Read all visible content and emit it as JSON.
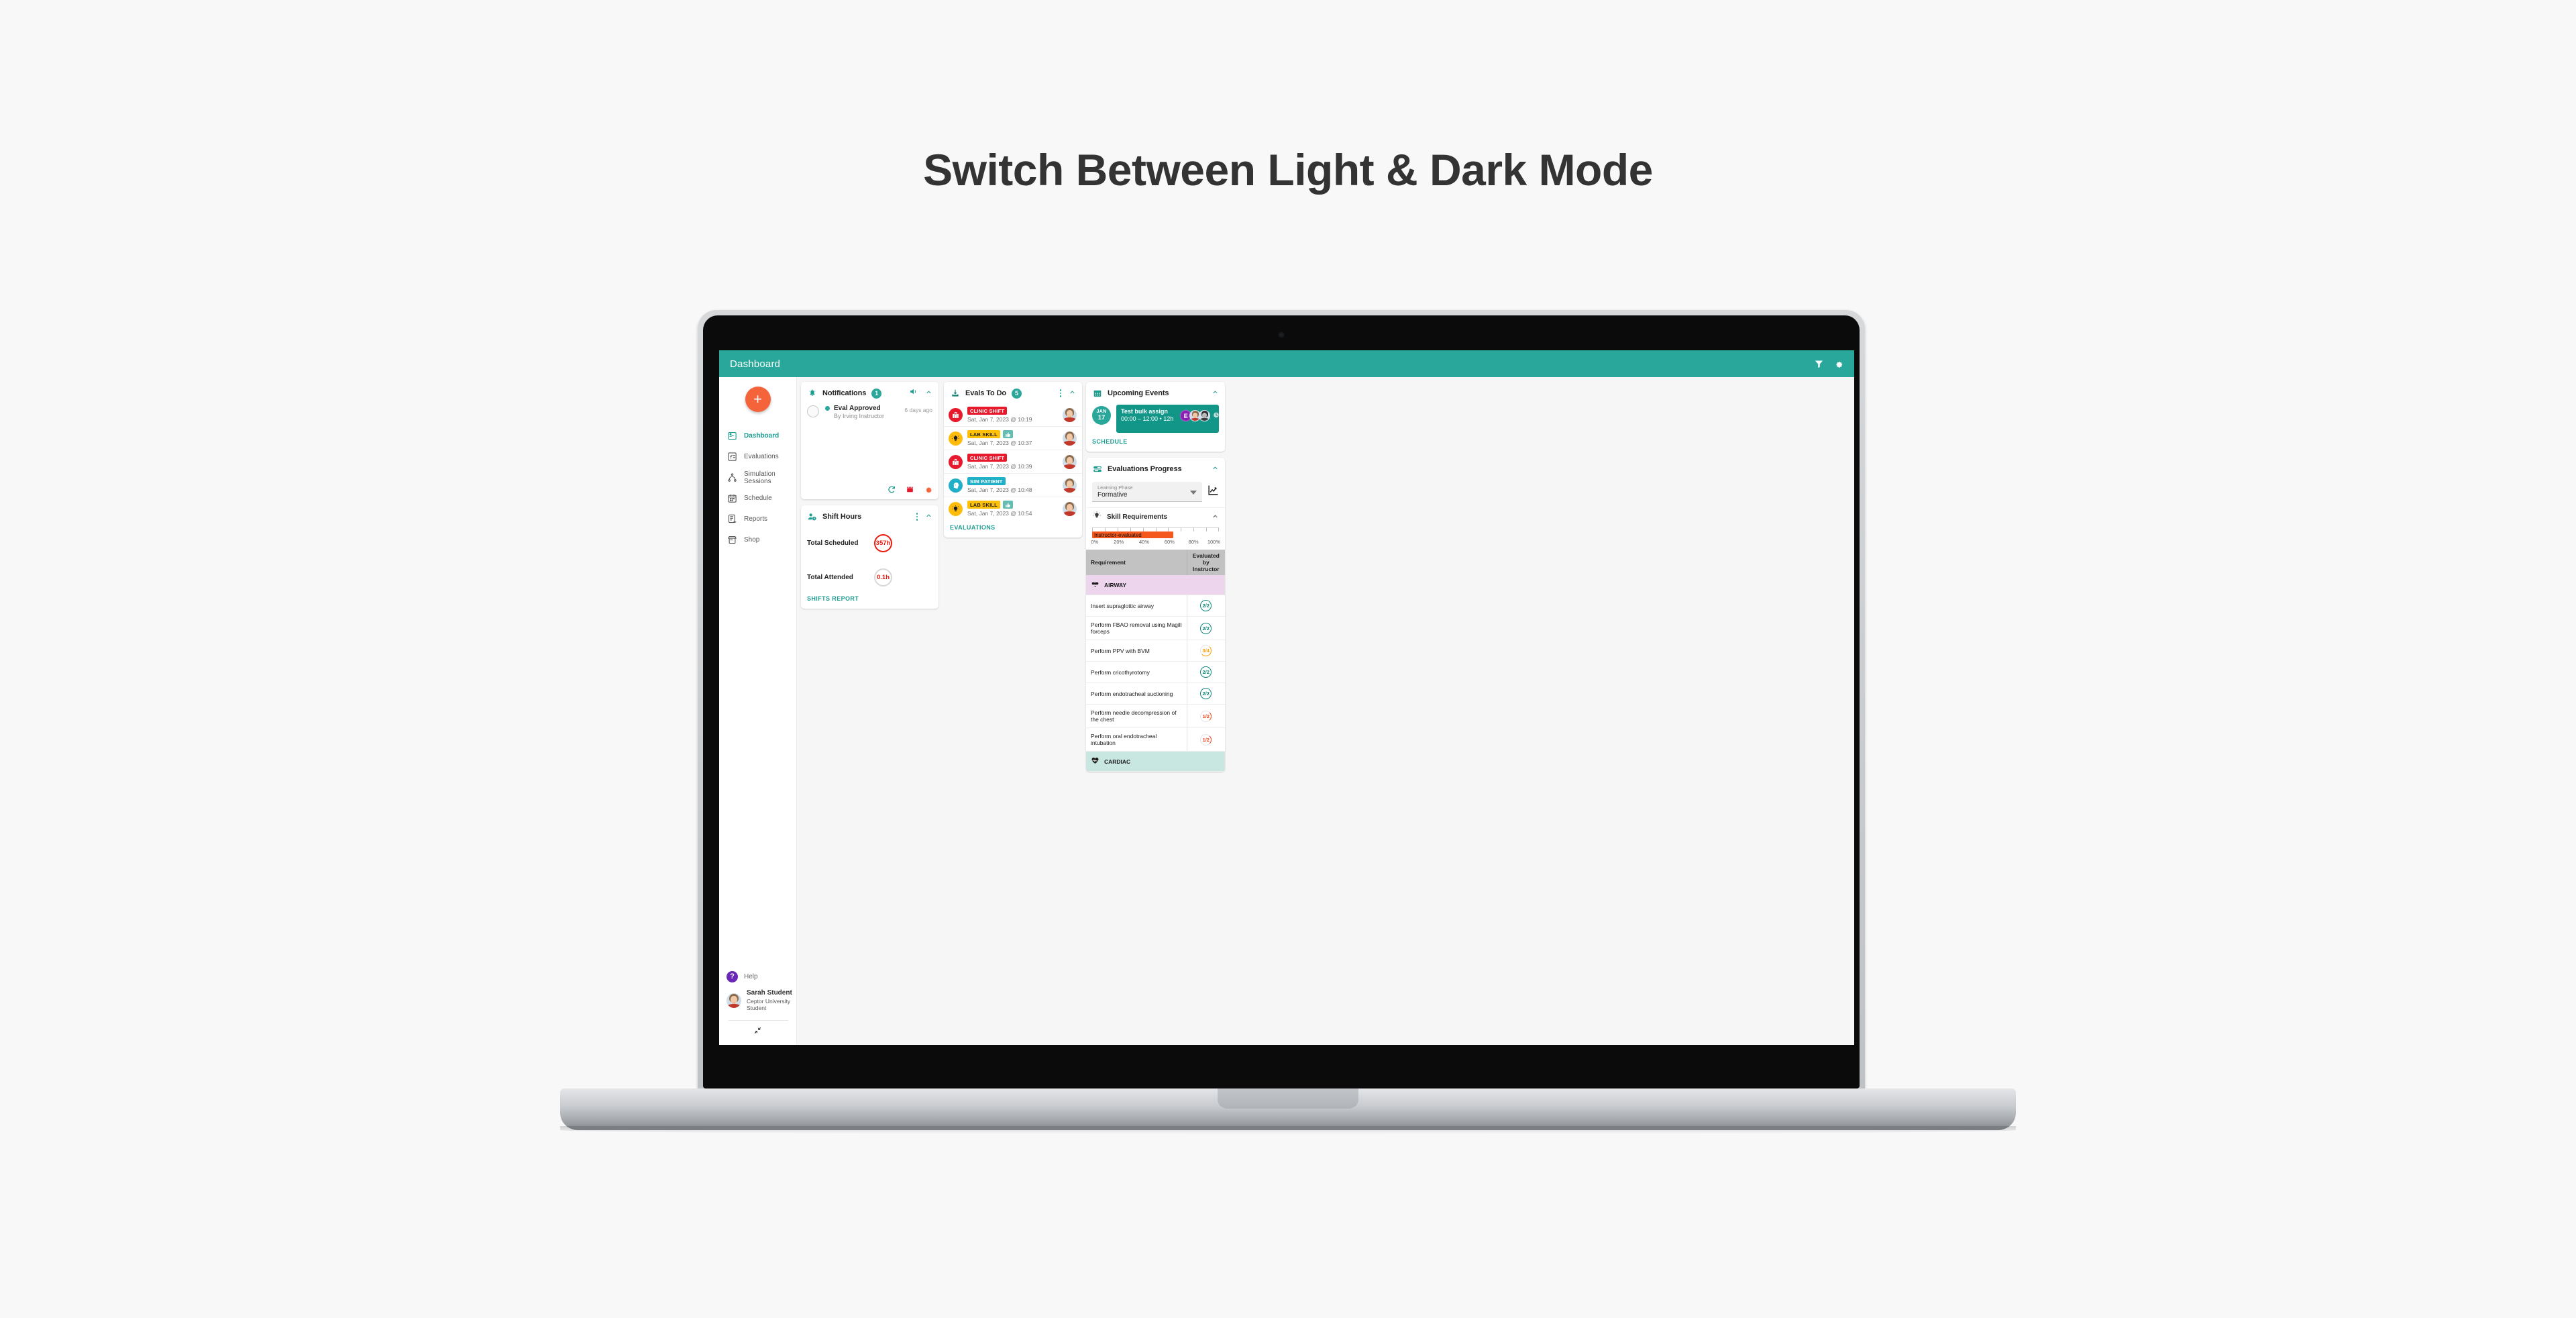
{
  "page": {
    "heading": "Switch Between Light & Dark Mode"
  },
  "appbar": {
    "title": "Dashboard",
    "filter_icon": "filter-icon",
    "settings_icon": "gear-icon"
  },
  "sidebar": {
    "add_button": "+",
    "items": [
      {
        "label": "Dashboard",
        "icon": "dashboard-icon",
        "active": true
      },
      {
        "label": "Evaluations",
        "icon": "checklist-icon",
        "active": false
      },
      {
        "label": "Simulation Sessions",
        "icon": "simulation-icon",
        "active": false
      },
      {
        "label": "Schedule",
        "icon": "calendar-icon",
        "active": false
      },
      {
        "label": "Reports",
        "icon": "report-icon",
        "active": false
      },
      {
        "label": "Shop",
        "icon": "shop-icon",
        "active": false
      }
    ],
    "help": {
      "label": "Help",
      "icon": "question-mark-icon"
    },
    "user": {
      "name": "Sarah Student",
      "organization": "Ceptor University",
      "role": "Student"
    },
    "collapse_icon": "collapse-arrows-icon"
  },
  "notifications": {
    "title": "Notifications",
    "count": "1",
    "sound_icon": "speaker-icon",
    "collapse_icon": "chevron-up-icon",
    "items": [
      {
        "title": "Eval Approved",
        "subtitle": "By Irving Instructor",
        "time": "6 days ago"
      }
    ],
    "footer_icons": [
      "refresh-icon",
      "trash-icon",
      "gear-icon"
    ]
  },
  "shift_hours": {
    "title": "Shift Hours",
    "menu_icon": "kebab-menu-icon",
    "collapse_icon": "chevron-up-icon",
    "rows": [
      {
        "label": "Total Scheduled",
        "value": "357h",
        "style": "red"
      },
      {
        "label": "Total Attended",
        "value": "0.1h",
        "style": "grey"
      }
    ],
    "link": "SHIFTS REPORT"
  },
  "evals_to_do": {
    "title": "Evals To Do",
    "count": "5",
    "menu_icon": "kebab-menu-icon",
    "collapse_icon": "chevron-up-icon",
    "link": "EVALUATIONS",
    "items": [
      {
        "tag": "CLINIC SHIFT",
        "tag_color": "#e8192c",
        "icon": "hospital-icon",
        "icon_bg": "#e8192c",
        "thumb": false,
        "date": "Sat, Jan 7, 2023  @  10:19"
      },
      {
        "tag": "LAB SKILL",
        "tag_color": "#ffc107",
        "icon": "lightbulb-icon",
        "icon_bg": "#ffbc0a",
        "thumb": true,
        "date": "Sat, Jan 7, 2023  @  10:37"
      },
      {
        "tag": "CLINIC SHIFT",
        "tag_color": "#e8192c",
        "icon": "hospital-icon",
        "icon_bg": "#e8192c",
        "thumb": false,
        "date": "Sat, Jan 7, 2023  @  10:39"
      },
      {
        "tag": "SIM PATIENT",
        "tag_color": "#22b0c9",
        "icon": "head-icon",
        "icon_bg": "#22b0c9",
        "thumb": false,
        "date": "Sat, Jan 7, 2023  @  10:48"
      },
      {
        "tag": "LAB SKILL",
        "tag_color": "#ffc107",
        "icon": "lightbulb-icon",
        "icon_bg": "#ffbc0a",
        "thumb": true,
        "date": "Sat, Jan 7, 2023  @  10:54"
      }
    ]
  },
  "upcoming_events": {
    "title": "Upcoming Events",
    "icon": "calendar-icon",
    "collapse_icon": "chevron-up-icon",
    "link": "SCHEDULE",
    "event": {
      "month": "JAN",
      "day": "17",
      "title": "Test bulk assign",
      "time": "00:00 – 12:00 • 12h",
      "initial": "E",
      "pending_icon": "clock-question-icon"
    }
  },
  "evaluations_progress": {
    "title": "Evaluations Progress",
    "icon": "progress-bars-icon",
    "collapse_icon": "chevron-up-icon",
    "select": {
      "label": "Learning Phase",
      "value": "Formative"
    },
    "chart_icon": "trend-chart-icon",
    "skill_requirements": {
      "title": "Skill Requirements",
      "icon": "lightbulb-icon",
      "collapse_icon": "chevron-up-icon"
    },
    "table": {
      "headers": [
        "Requirement",
        "Evaluated by Instructor"
      ],
      "groups": [
        {
          "name": "AIRWAY",
          "icon": "airway-mask-icon",
          "rows": [
            {
              "requirement": "Insert supraglottic airway",
              "score": "2/2",
              "state": "full"
            },
            {
              "requirement": "Perform FBAO removal using Magill forceps",
              "score": "2/2",
              "state": "full"
            },
            {
              "requirement": "Perform PPV with BVM",
              "score": "3/4",
              "state": "part"
            },
            {
              "requirement": "Perform cricothyrotomy",
              "score": "2/2",
              "state": "full"
            },
            {
              "requirement": "Perform endotracheal suctioning",
              "score": "2/2",
              "state": "full"
            },
            {
              "requirement": "Perform needle decompression of the chest",
              "score": "1/2",
              "state": "low"
            },
            {
              "requirement": "Perform oral endotracheal intubation",
              "score": "1/2",
              "state": "low"
            }
          ]
        },
        {
          "name": "CARDIAC",
          "icon": "heartbeat-icon",
          "rows": []
        }
      ]
    }
  },
  "chart_data": {
    "type": "bar",
    "title": "Skill Requirements",
    "categories": [
      "Instructor-evaluated"
    ],
    "values": [
      64
    ],
    "xlabel": "",
    "ylabel": "",
    "xlim": [
      0,
      100
    ],
    "tick_labels": [
      "0%",
      "20%",
      "40%",
      "60%",
      "80%",
      "100%"
    ],
    "tick_values": [
      0,
      20,
      40,
      60,
      80,
      100
    ],
    "bar_color": "#f4581c",
    "orientation": "horizontal",
    "grid": false,
    "legend": "none"
  }
}
